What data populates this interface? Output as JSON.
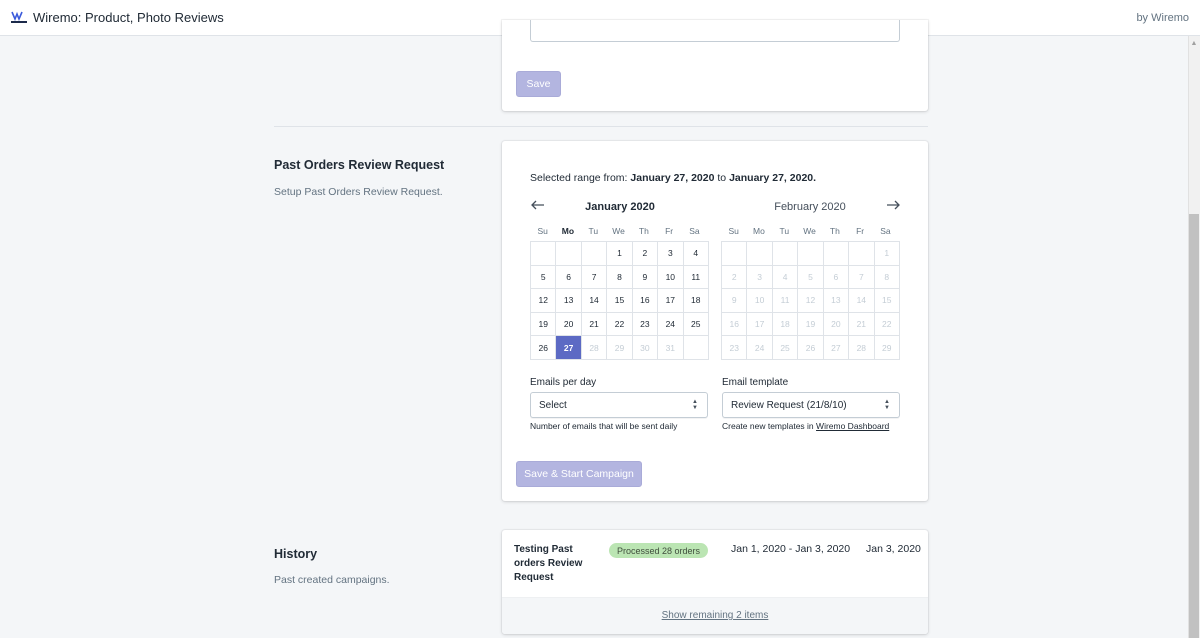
{
  "topbar": {
    "app_title": "Wiremo: Product, Photo Reviews",
    "by_label": "by Wiremo",
    "logo_icon": "wiremo-logo-icon"
  },
  "top_card": {
    "save_label": "Save"
  },
  "past_orders": {
    "title": "Past Orders Review Request",
    "description": "Setup Past Orders Review Request.",
    "range_prefix": "Selected range from:",
    "range_start": "January 27, 2020",
    "range_mid": "to",
    "range_end": "January 27, 2020.",
    "prev_icon": "arrow-left-icon",
    "next_icon": "arrow-right-icon",
    "calendar_left": {
      "month": "January 2020",
      "weekdays": [
        "Su",
        "Mo",
        "Tu",
        "We",
        "Th",
        "Fr",
        "Sa"
      ],
      "bold_weekday": "Mo",
      "weeks": [
        [
          "",
          "",
          "",
          "1",
          "2",
          "3",
          "4"
        ],
        [
          "5",
          "6",
          "7",
          "8",
          "9",
          "10",
          "11"
        ],
        [
          "12",
          "13",
          "14",
          "15",
          "16",
          "17",
          "18"
        ],
        [
          "19",
          "20",
          "21",
          "22",
          "23",
          "24",
          "25"
        ],
        [
          "26",
          "27",
          "28",
          "29",
          "30",
          "31",
          ""
        ]
      ],
      "selected": "27",
      "disabled_after": "27"
    },
    "calendar_right": {
      "month": "February 2020",
      "weekdays": [
        "Su",
        "Mo",
        "Tu",
        "We",
        "Th",
        "Fr",
        "Sa"
      ],
      "weeks": [
        [
          "",
          "",
          "",
          "",
          "",
          "",
          "1"
        ],
        [
          "2",
          "3",
          "4",
          "5",
          "6",
          "7",
          "8"
        ],
        [
          "9",
          "10",
          "11",
          "12",
          "13",
          "14",
          "15"
        ],
        [
          "16",
          "17",
          "18",
          "19",
          "20",
          "21",
          "22"
        ],
        [
          "23",
          "24",
          "25",
          "26",
          "27",
          "28",
          "29"
        ]
      ]
    },
    "emails_per_day": {
      "label": "Emails per day",
      "value": "Select",
      "help": "Number of emails that will be sent daily"
    },
    "email_template": {
      "label": "Email template",
      "value": "Review Request (21/8/10)",
      "help_prefix": "Create new templates in",
      "help_link": "Wiremo Dashboard"
    },
    "start_button": "Save & Start Campaign"
  },
  "history": {
    "title": "History",
    "description": "Past created campaigns.",
    "items": [
      {
        "name": "Testing Past orders Review Request",
        "status": "Processed 28 orders",
        "range": "Jan 1, 2020 - Jan 3, 2020",
        "date": "Jan 3, 2020"
      }
    ],
    "show_more": "Show remaining 2 items"
  },
  "colors": {
    "accent": "#5c6ac4",
    "disabled_button": "#b3b5e0",
    "badge_bg": "#bbe5b3",
    "background": "#f4f6f8"
  }
}
